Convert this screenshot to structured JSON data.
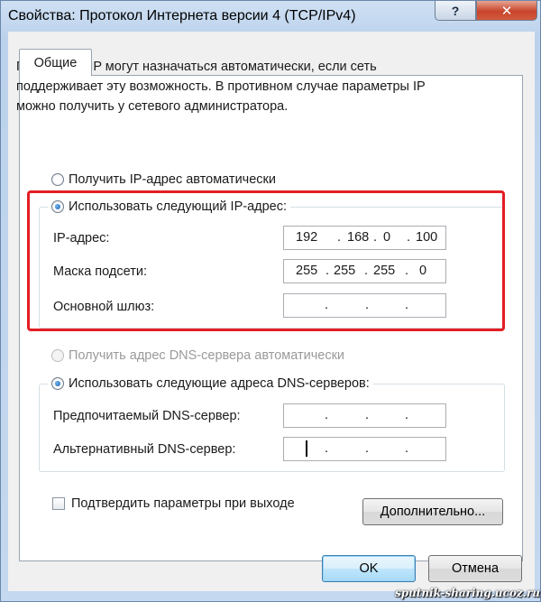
{
  "window": {
    "title": "Свойства: Протокол Интернета версии 4 (TCP/IPv4)",
    "help_label": "?",
    "close_label": "✕"
  },
  "tab": {
    "label": "Общие"
  },
  "description": "Параметры IP могут назначаться автоматически, если сеть поддерживает эту возможность. В противном случае параметры IP можно получить у сетевого администратора.",
  "ip_section": {
    "auto_label": "Получить IP-адрес автоматически",
    "manual_label": "Использовать следующий IP-адрес:",
    "selected": "manual",
    "fields": [
      {
        "label": "IP-адрес:",
        "octets": [
          "192",
          "168",
          "0",
          "100"
        ]
      },
      {
        "label": "Маска подсети:",
        "octets": [
          "255",
          "255",
          "255",
          "0"
        ]
      },
      {
        "label": "Основной шлюз:",
        "octets": [
          "",
          "",
          "",
          ""
        ]
      }
    ]
  },
  "dns_section": {
    "auto_label": "Получить адрес DNS-сервера автоматически",
    "manual_label": "Использовать следующие адреса DNS-серверов:",
    "selected": "manual",
    "fields": [
      {
        "label": "Предпочитаемый DNS-сервер:",
        "octets": [
          "",
          "",
          "",
          ""
        ]
      },
      {
        "label": "Альтернативный DNS-сервер:",
        "octets": [
          "",
          "",
          "",
          ""
        ]
      }
    ]
  },
  "validate_on_exit": {
    "label": "Подтвердить параметры при выходе",
    "checked": false
  },
  "buttons": {
    "advanced": "Дополнительно...",
    "ok": "OK",
    "cancel": "Отмена"
  },
  "separator": ".",
  "watermark": "sputnik-sharing.ucoz.ru",
  "colors": {
    "highlight_frame": "#e31e24",
    "radio_selected": "#1c5fa7"
  }
}
